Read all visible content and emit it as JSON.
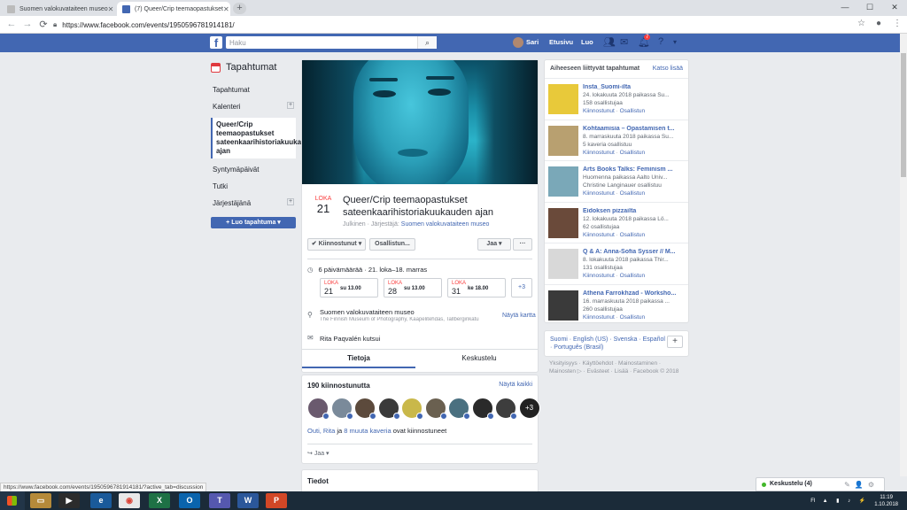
{
  "browser": {
    "tabs": [
      {
        "title": "Suomen valokuvataiteen museo",
        "active": false
      },
      {
        "title": "(7) Queer/Crip teemaopastukset",
        "active": true
      }
    ],
    "url": "https://www.facebook.com/events/1950596781914181/",
    "status_url": "https://www.facebook.com/events/1950596781914181/?active_tab=discussion"
  },
  "fb_header": {
    "search_placeholder": "Haku",
    "user": "Sari",
    "home": "Etusivu",
    "create": "Luo",
    "notif_count": "7"
  },
  "sidebar": {
    "title": "Tapahtumat",
    "items": [
      {
        "label": "Tapahtumat"
      },
      {
        "label": "Kalenteri"
      },
      {
        "label": "Queer/Crip teemaopastukset sateenkaarihistoriakuukauden ajan"
      },
      {
        "label": "Syntymäpäivät"
      },
      {
        "label": "Tutki"
      },
      {
        "label": "Järjestäjänä"
      }
    ],
    "create_button": "+ Luo tapahtuma ▾"
  },
  "event": {
    "month": "LOKA",
    "day": "21",
    "title": "Queer/Crip teemaopastukset sateenkaarihistoriakuukauden ajan",
    "visibility": "Julkinen",
    "organizer_label": "Järjestäjä:",
    "organizer": "Suomen valokuvataiteen museo",
    "interested_btn": "✔ Kiinnostunut ▾",
    "going_btn": "Osallistun...",
    "share_btn": "Jaa ▾",
    "more_btn": "···",
    "dates_summary": "6 päivämäärää · 21. loka–18. marras",
    "dates": [
      {
        "month": "LOKA",
        "day": "21",
        "time": "su 13.00"
      },
      {
        "month": "LOKA",
        "day": "28",
        "time": "su 13.00"
      },
      {
        "month": "LOKA",
        "day": "31",
        "time": "ke 18.00"
      }
    ],
    "more_dates": "+3",
    "location_name": "Suomen valokuvataiteen museo",
    "location_address": "The Finnish Museum of Photography, Kaapelitehdas, Tallberginkatu",
    "show_map": "Näytä kartta",
    "invited_by": "Rita Paqvalén kutsui",
    "tab_info": "Tietoja",
    "tab_discussion": "Keskustelu"
  },
  "interested": {
    "title": "190 kiinnostunutta",
    "show_all": "Näytä kaikki",
    "extra_count": "+3",
    "names_a": "Outi, Rita",
    "names_mid": " ja ",
    "names_b": "8 muuta kaveria",
    "names_tail": " ovat kiinnostuneet",
    "share": "Jaa ▾",
    "face_colors": [
      "#6a5a6e",
      "#7a8a9a",
      "#5c4a3c",
      "#3a3a3a",
      "#c9b84a",
      "#6a6050",
      "#4a7080",
      "#2a2a2a",
      "#3d3d3d"
    ]
  },
  "details": {
    "title": "Tiedot"
  },
  "related": {
    "title": "Aiheeseen liittyvät tapahtumat",
    "see_more": "Katso lisää",
    "items": [
      {
        "title": "Insta_Suomi-ilta",
        "line1": "24. lokakuuta 2018 paikassa Su...",
        "line2": "158 osallistujaa",
        "color": "#e8c93a"
      },
      {
        "title": "Kohtaamisia – Opastamisen t...",
        "line1": "8. marraskuuta 2018 paikassa Su...",
        "line2": "5 kaveria osallistuu",
        "color": "#b8a070"
      },
      {
        "title": "Arts Books Talks: Feminism ...",
        "line1": "Huomenna paikassa Aalto Univ...",
        "line2": "Christine Langinauer osallistuu",
        "color": "#7aa8b8"
      },
      {
        "title": "Eidoksen pizzailta",
        "line1": "12. lokakuuta 2018 paikassa Lö...",
        "line2": "62 osallistujaa",
        "color": "#6a4a3a"
      },
      {
        "title": "Q & A: Anna-Sofia Sysser // M...",
        "line1": "8. lokakuuta 2018 paikassa Thir...",
        "line2": "131 osallistujaa",
        "color": "#d8d8d8"
      },
      {
        "title": "Athena Farrokhzad - Worksho...",
        "line1": "16. marraskuuta 2018 paikassa ...",
        "line2": "260 osallistujaa",
        "color": "#3a3a3a"
      }
    ],
    "action_interested": "Kiinnostunut",
    "action_sep": " · ",
    "action_going": "Osallistun"
  },
  "languages": "Suomi · English (US) · Svenska · Español · Português (Brasil)",
  "footer": "Yksityisyys · Käyttöehdot · Mainostaminen · Mainosten ▷ · Evästeet · Lisää · Facebook © 2018",
  "chat": {
    "label": "Keskustelu (4)"
  },
  "taskbar": {
    "time": "11:19",
    "date": "1.10.2018",
    "lang": "FI"
  }
}
